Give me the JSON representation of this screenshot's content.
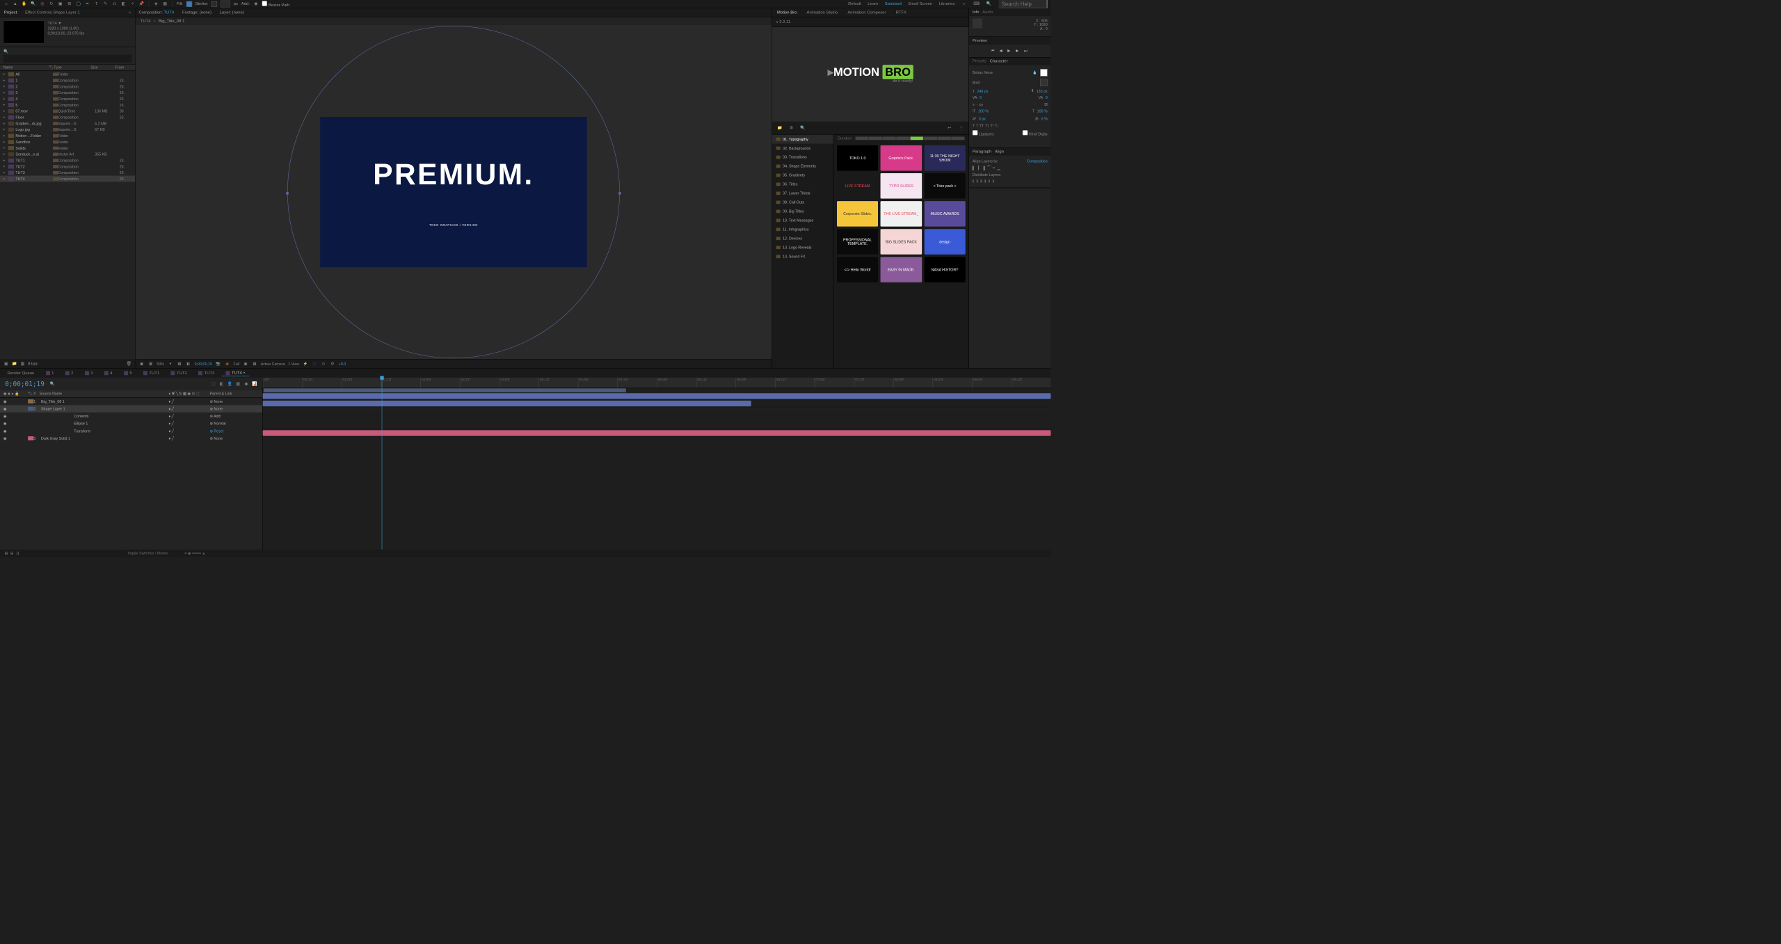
{
  "toolbar": {
    "fill_label": "Fill:",
    "stroke_label": "Stroke:",
    "px_label": "px",
    "add_label": "Add:",
    "bezier_label": "Bezier Path",
    "workspaces": [
      "Default",
      "Learn",
      "Standard",
      "Small Screen",
      "Libraries"
    ],
    "search_placeholder": "Search Help"
  },
  "project": {
    "tab_project": "Project",
    "tab_effects": "Effect Controls Shape Layer 1",
    "comp_name": "TUT4",
    "comp_res": "1920 x 1080 (1.00)",
    "comp_dur": "0;00;10;00, 23.976 fps",
    "col_name": "Name",
    "col_type": "Type",
    "col_size": "Size",
    "col_frame": "Fram",
    "items": [
      {
        "name": "All",
        "type": "Folder",
        "size": "",
        "fr": ""
      },
      {
        "name": "1",
        "type": "Composition",
        "size": "",
        "fr": "23."
      },
      {
        "name": "2",
        "type": "Composition",
        "size": "",
        "fr": "23."
      },
      {
        "name": "3",
        "type": "Composition",
        "size": "",
        "fr": "23."
      },
      {
        "name": "4",
        "type": "Composition",
        "size": "",
        "fr": "23."
      },
      {
        "name": "5",
        "type": "Composition",
        "size": "",
        "fr": "23."
      },
      {
        "name": "07.mov",
        "type": "QuickTime",
        "size": "136 MB",
        "fr": "30"
      },
      {
        "name": "Floor",
        "type": "Composition",
        "size": "",
        "fr": "23."
      },
      {
        "name": "Gradien...sk.jpg",
        "type": "Importe...G",
        "size": "5.2 MB",
        "fr": ""
      },
      {
        "name": "Logo.jpg",
        "type": "Importe...G",
        "size": "67 KB",
        "fr": ""
      },
      {
        "name": "Motion ...Folder",
        "type": "Folder",
        "size": "",
        "fr": ""
      },
      {
        "name": "Sandbox",
        "type": "Folder",
        "size": "",
        "fr": ""
      },
      {
        "name": "Solids",
        "type": "Folder",
        "size": "",
        "fr": ""
      },
      {
        "name": "Sonduck...o.ai",
        "type": "Vector Art",
        "size": "355 KB",
        "fr": ""
      },
      {
        "name": "TUT1",
        "type": "Composition",
        "size": "",
        "fr": "23."
      },
      {
        "name": "TUT2",
        "type": "Composition",
        "size": "",
        "fr": "23."
      },
      {
        "name": "TUT3",
        "type": "Composition",
        "size": "",
        "fr": "23."
      },
      {
        "name": "TUT4",
        "type": "Composition",
        "size": "",
        "fr": "23."
      }
    ],
    "bpc": "8 bpc"
  },
  "viewer": {
    "tab_comp": "Composition:",
    "tab_comp_name": "TUT4",
    "tab_footage": "Footage: (none)",
    "tab_layer": "Layer: (none)",
    "breadcrumb1": "TUT4",
    "breadcrumb2": "Big_Title_08 1",
    "main_text": "PREMIUM.",
    "sub_text": "TOKO GRAPHICS / VERSION",
    "zoom": "50%",
    "timecode": "0;00;01;19",
    "res": "Full",
    "camera": "Active Camera",
    "views": "1 View",
    "exposure": "+0.0"
  },
  "motionbro": {
    "tab1": "Motion Bro",
    "tab2": "Animation Studio",
    "tab3": "Animation Composer",
    "tab4": "RTFX",
    "version": "v 2.2.11",
    "logo_motion": "MOTION",
    "logo_bro": "BRO",
    "tagline": "do it nicely!",
    "duration_label": "Duration:",
    "categories": [
      "01. Typography",
      "02. Backgrounds",
      "03. Transitions",
      "04. Shape Elements",
      "05. Gradients",
      "06. Titles",
      "07. Lower Thirds",
      "08. Call-Outs",
      "09. Big Titles",
      "10. Text Messages",
      "11. Infographics",
      "12. Devices",
      "13. Logo Reveals",
      "14. Sound FX"
    ],
    "presets": [
      {
        "label": "TOKO 1.0",
        "bg": "#000",
        "color": "#fff"
      },
      {
        "label": "Graphics Pack.",
        "bg": "#d83a8a",
        "color": "#fff"
      },
      {
        "label": "11:30 THE NIGHT SHOW",
        "bg": "#2a2a5a",
        "color": "#fff"
      },
      {
        "label": "LIVE STREAM",
        "bg": "#1a1a1a",
        "color": "#e84a5a"
      },
      {
        "label": "TYPO SLIDES",
        "bg": "#f5e5f0",
        "color": "#d83a8a"
      },
      {
        "label": "< Toko pack >",
        "bg": "#0a0a0a",
        "color": "#fff"
      },
      {
        "label": "Corporate Slides.",
        "bg": "#f5c53a",
        "color": "#333"
      },
      {
        "label": "THE LIVE STREAM_",
        "bg": "#f0f0f0",
        "color": "#e84a5a"
      },
      {
        "label": "MUSIC AWARDS",
        "bg": "#5a4a9a",
        "color": "#fff"
      },
      {
        "label": "PROFESSIONAL TEMPLATE.",
        "bg": "#0a0a0a",
        "color": "#fff"
      },
      {
        "label": "BIG SLIDES PACK",
        "bg": "#f5d5d5",
        "color": "#333"
      },
      {
        "label": "design",
        "bg": "#3a5ad8",
        "color": "#fff"
      },
      {
        "label": "</> Hello World!",
        "bg": "#0a0a0a",
        "color": "#fff"
      },
      {
        "label": "EASY IN MADE.",
        "bg": "#8a5a9a",
        "color": "#fff"
      },
      {
        "label": "NASA HISTORY",
        "bg": "#000",
        "color": "#fff"
      }
    ]
  },
  "right": {
    "info_tab": "Info",
    "audio_tab": "Audio",
    "info_x": "X : 806",
    "info_y": "Y : 1690",
    "info_a": "A : 0",
    "preview_tab": "Preview",
    "presets_tab": "Presets",
    "character_tab": "Character",
    "font": "Bebas Neue",
    "font_style": "Bold",
    "font_size": "240 px",
    "leading": "155 px",
    "tracking": "0",
    "kerning": "0",
    "vscale": "100 %",
    "hscale": "100 %",
    "baseline": "0 px",
    "tsume": "0 %",
    "ligatures": "Ligatures",
    "hindi": "Hindi Digits",
    "paragraph_tab": "Paragraph",
    "align_tab": "Align",
    "align_to": "Align Layers to:",
    "align_val": "Composition",
    "distribute": "Distribute Layers:"
  },
  "timeline": {
    "render_queue": "Render Queue",
    "tabs": [
      "1",
      "2",
      "3",
      "4",
      "5",
      "TUT1",
      "TUT2",
      "TUT3",
      "TUT4"
    ],
    "timecode": "0;00;01;19",
    "col_source": "Source Name",
    "col_parent": "Parent & Link",
    "layers": [
      {
        "num": "1",
        "name": "Big_Title_08 1",
        "parent": "None",
        "color": "#8a6a4a"
      },
      {
        "num": "2",
        "name": "Shape Layer 1",
        "parent": "None",
        "color": "#4a5a8a",
        "selected": true
      },
      {
        "num": "",
        "name": "Contents",
        "parent": "Add:",
        "sub": true
      },
      {
        "num": "",
        "name": "Ellipse 1",
        "parent": "Normal",
        "sub": true
      },
      {
        "num": "",
        "name": "Transform",
        "parent": "Reset",
        "sub": true,
        "reset": true
      },
      {
        "num": "3",
        "name": "Dark Gray Solid 1",
        "parent": "None",
        "color": "#c85a7a"
      }
    ],
    "ruler": [
      "00f",
      "00;12f",
      "01;00f",
      "01;12f",
      "02;00f",
      "02;12f",
      "03;00f",
      "03;12f",
      "04;00f",
      "04;12f",
      "05;00f",
      "05;12f",
      "06;00f",
      "06;12f",
      "07;00f",
      "07;12f",
      "08;00f",
      "08;12f",
      "09;00f",
      "09;12f"
    ],
    "toggle": "Toggle Switches / Modes"
  }
}
